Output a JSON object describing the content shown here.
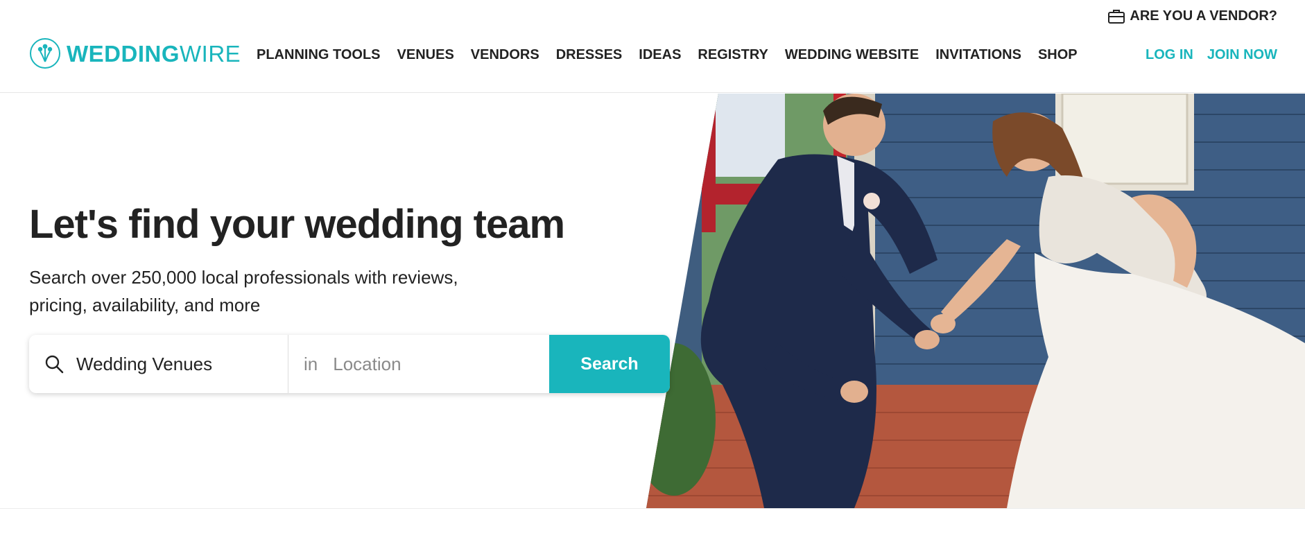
{
  "header": {
    "vendor_link": "ARE YOU A VENDOR?",
    "logo": {
      "wedding": "WEDDING",
      "wire": "WIRE"
    },
    "nav": [
      {
        "label": "PLANNING TOOLS"
      },
      {
        "label": "VENUES"
      },
      {
        "label": "VENDORS"
      },
      {
        "label": "DRESSES"
      },
      {
        "label": "IDEAS"
      },
      {
        "label": "REGISTRY"
      },
      {
        "label": "WEDDING WEBSITE"
      },
      {
        "label": "INVITATIONS"
      },
      {
        "label": "SHOP"
      }
    ],
    "login": "LOG IN",
    "join": "JOIN NOW"
  },
  "hero": {
    "title": "Let's find your wedding team",
    "subtitle": "Search over 250,000 local professionals with reviews, pricing, availability, and more"
  },
  "search": {
    "category_value": "Wedding Venues",
    "in_label": "in",
    "location_placeholder": "Location",
    "button": "Search"
  },
  "colors": {
    "brand": "#19b5bc",
    "text": "#222222"
  }
}
